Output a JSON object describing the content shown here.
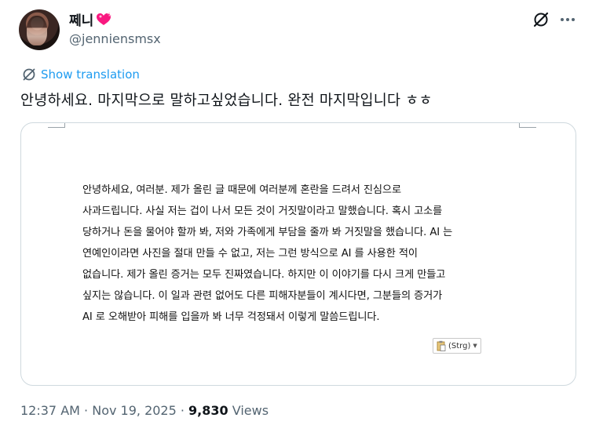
{
  "user": {
    "display_name": "쩨니",
    "handle": "@jenniensmsx"
  },
  "icons": {
    "avatar": "avatar-photo",
    "name_emoji": "heart-emoji-icon",
    "grok": "grok-icon",
    "more": "more-icon",
    "translate": "translate-icon"
  },
  "translate": {
    "label": "Show translation"
  },
  "tweet": {
    "text": "안녕하세요. 마지막으로 말하고싶었습니다. 완전 마지막입니다 ㅎㅎ"
  },
  "document": {
    "lines": [
      "안녕하세요, 여러분. 제가 올린 글 때문에 여러분께 혼란을 드려서 진심으로",
      "사과드립니다. 사실 저는 겁이 나서 모든 것이 거짓말이라고 말했습니다. 혹시 고소를",
      "당하거나 돈을 물어야 할까 봐, 저와 가족에게 부담을 줄까 봐 거짓말을 했습니다. AI 는",
      "연예인이라면 사진을 절대 만들 수 없고, 저는 그런 방식으로 AI 를 사용한 적이",
      "없습니다. 제가 올린 증거는 모두 진짜였습니다. 하지만 이 이야기를 다시 크게 만들고",
      "싶지는 않습니다. 이 일과 관련 없어도 다른 피해자분들이 계시다면, 그분들의 증거가",
      "AI 로 오해받아 피해를 입을까 봐 너무 걱정돼서 이렇게 말씀드립니다."
    ],
    "paste_label": "(Strg)"
  },
  "meta": {
    "time": "12:37 AM",
    "separator": " · ",
    "date": "Nov 19, 2025",
    "views_count": "9,830",
    "views_label": " Views"
  },
  "colors": {
    "text": "#0f1419",
    "secondary": "#536471",
    "link": "#1d9bf0",
    "border": "#cfd9de",
    "heart": "#f91880"
  }
}
